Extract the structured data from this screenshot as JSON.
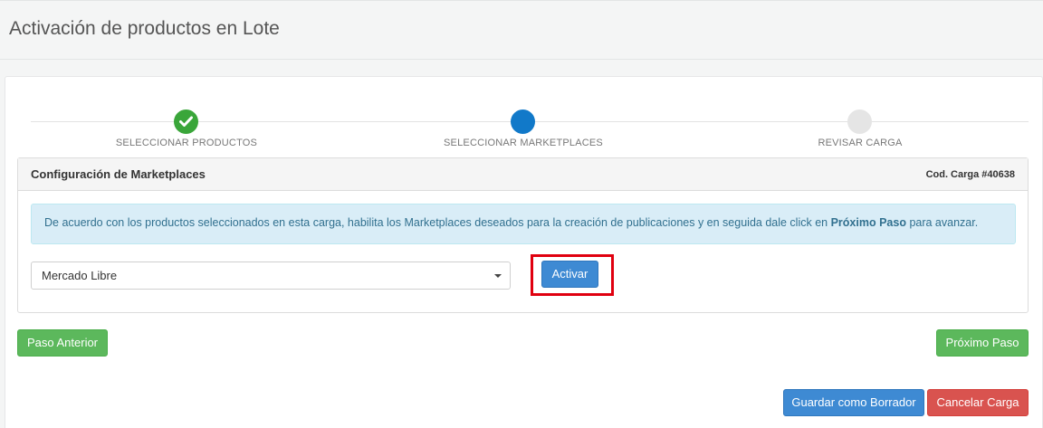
{
  "header": {
    "title": "Activación de productos en Lote"
  },
  "stepper": {
    "steps": [
      {
        "label": "SELECCIONAR PRODUCTOS",
        "state": "done"
      },
      {
        "label": "SELECCIONAR MARKETPLACES",
        "state": "current"
      },
      {
        "label": "REVISAR CARGA",
        "state": "pending"
      }
    ]
  },
  "panel": {
    "title": "Configuración de Marketplaces",
    "code": "Cod. Carga #40638",
    "info_text_before": "De acuerdo con los productos seleccionados en esta carga, habilita los Marketplaces deseados para la creación de publicaciones y en seguida dale click en ",
    "info_text_bold": "Próximo Paso",
    "info_text_after": " para avanzar.",
    "marketplace_select": {
      "value": "Mercado Libre"
    },
    "activate_label": "Activar"
  },
  "navigation": {
    "prev_label": "Paso Anterior",
    "next_label": "Próximo Paso"
  },
  "footer": {
    "draft_label": "Guardar como Borrador",
    "cancel_label": "Cancelar Carga"
  },
  "colors": {
    "done": "#3aa63a",
    "current": "#1179c9",
    "pending": "#e5e5e5",
    "highlight": "#e0000f"
  }
}
